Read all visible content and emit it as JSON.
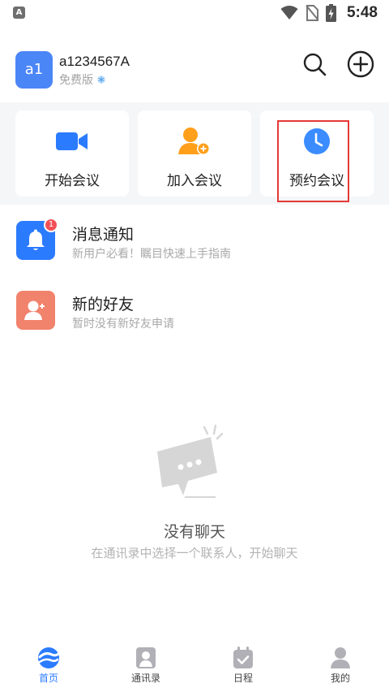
{
  "status_bar": {
    "app_icon_letter": "A",
    "time": "5:48",
    "icons": [
      "wifi-icon",
      "no-sim-icon",
      "battery-charging-icon"
    ]
  },
  "header": {
    "avatar_text": "a1",
    "username": "a1234567A",
    "plan": "免费版",
    "plan_icon": "snowflake-badge-icon",
    "actions": [
      "search-icon",
      "add-circle-icon"
    ]
  },
  "quick_actions": [
    {
      "label": "开始会议",
      "icon": "video-camera-icon",
      "color": "#2b7bff"
    },
    {
      "label": "加入会议",
      "icon": "add-user-icon",
      "color": "#ff9f1a"
    },
    {
      "label": "预约会议",
      "icon": "clock-icon",
      "color": "#3b8cff"
    }
  ],
  "list": [
    {
      "title": "消息通知",
      "subtitle": "新用户必看！瞩目快速上手指南",
      "badge": "1",
      "icon": "bell-icon",
      "color": "#2b7bff"
    },
    {
      "title": "新的好友",
      "subtitle": "暂时没有新好友申请",
      "icon": "add-friend-icon",
      "color": "#f1826c"
    }
  ],
  "empty_state": {
    "title": "没有聊天",
    "subtitle": "在通讯录中选择一个联系人，开始聊天",
    "icon": "chat-bubble-icon"
  },
  "bottom_nav": [
    {
      "label": "首页",
      "icon": "home-logo-icon",
      "active": true
    },
    {
      "label": "通讯录",
      "icon": "contacts-icon",
      "active": false
    },
    {
      "label": "日程",
      "icon": "calendar-check-icon",
      "active": false
    },
    {
      "label": "我的",
      "icon": "person-icon",
      "active": false
    }
  ],
  "colors": {
    "accent": "#2b7bff",
    "highlight_border": "#e53935",
    "badge": "#f25058"
  }
}
